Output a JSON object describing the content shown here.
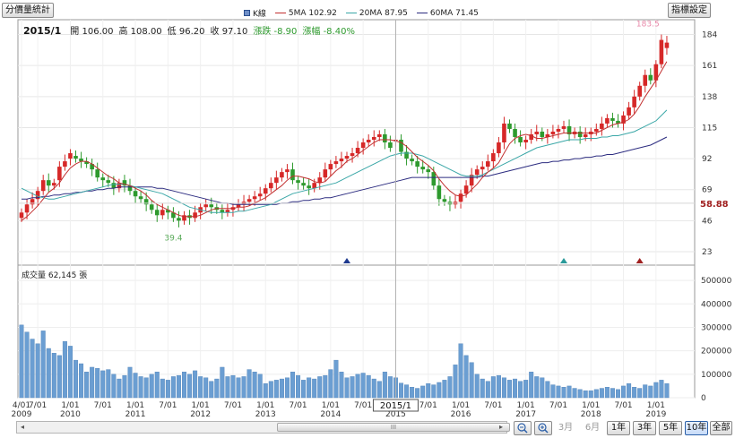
{
  "toolbar": {
    "stats_button": "分價量統計",
    "indicator_button": "指標設定"
  },
  "legend": [
    {
      "label": "K線",
      "color": "#2a4f8f"
    },
    {
      "label": "5MA 102.92",
      "color": "#c23030"
    },
    {
      "label": "20MA 87.95",
      "color": "#3aa7a7"
    },
    {
      "label": "60MA 71.45",
      "color": "#2c2c80"
    }
  ],
  "info": {
    "period": "2015/1",
    "open_label": "開",
    "open": "106.00",
    "high_label": "高",
    "high": "108.00",
    "low_label": "低",
    "low": "96.20",
    "close_label": "收",
    "close": "97.10",
    "change": "漲跌 -8.90",
    "change_pct": "漲幅 -8.40%"
  },
  "volume_label": "成交量 62,145 張",
  "colors": {
    "up": "#d62828",
    "down": "#2e9a2e",
    "volume": "#6b9ed2",
    "ma5": "#c23030",
    "ma20": "#3aa7a7",
    "ma60": "#2c2c80",
    "current_price": "#a02020",
    "cursor": "#b0b0b0"
  },
  "chart_data": {
    "type": "candlestick",
    "price_axis": {
      "ticks": [
        23,
        46,
        69,
        92,
        115,
        138,
        161,
        184
      ],
      "range": [
        13,
        195
      ]
    },
    "volume_axis": {
      "ticks": [
        0,
        100000,
        200000,
        300000,
        400000,
        500000
      ],
      "labels": [
        "0",
        "100000",
        "200000",
        "300000",
        "400000",
        "500000"
      ],
      "range": [
        0,
        550000
      ]
    },
    "x_ticks": [
      {
        "label": "4/01",
        "year": "2009",
        "i": 0
      },
      {
        "label": "7/01",
        "year": "",
        "i": 3
      },
      {
        "label": "1/01",
        "year": "2010",
        "i": 9
      },
      {
        "label": "7/01",
        "year": "",
        "i": 15
      },
      {
        "label": "1/01",
        "year": "2011",
        "i": 21
      },
      {
        "label": "7/01",
        "year": "",
        "i": 27
      },
      {
        "label": "1/01",
        "year": "2012",
        "i": 33
      },
      {
        "label": "7/01",
        "year": "",
        "i": 39
      },
      {
        "label": "1/01",
        "year": "2013",
        "i": 45
      },
      {
        "label": "7/01",
        "year": "",
        "i": 51
      },
      {
        "label": "1/01",
        "year": "2014",
        "i": 57
      },
      {
        "label": "7/01",
        "year": "",
        "i": 63
      },
      {
        "label": "",
        "year": "2015",
        "i": 69
      },
      {
        "label": "7/01",
        "year": "",
        "i": 75
      },
      {
        "label": "1/01",
        "year": "2016",
        "i": 81
      },
      {
        "label": "7/01",
        "year": "",
        "i": 87
      },
      {
        "label": "1/01",
        "year": "2017",
        "i": 93
      },
      {
        "label": "7/01",
        "year": "",
        "i": 99
      },
      {
        "label": "1/01",
        "year": "2018",
        "i": 105
      },
      {
        "label": "7/01",
        "year": "",
        "i": 111
      },
      {
        "label": "1/01",
        "year": "2019",
        "i": 117
      }
    ],
    "cursor_index": 69,
    "cursor_label": "2015/1",
    "current_price": "58.88",
    "current_price_value": 58.88,
    "max_annotation": {
      "label": "183.5",
      "i": 116,
      "value": 183.5
    },
    "min_annotation": {
      "label": "39.4",
      "i": 28,
      "value": 39.4
    },
    "markers": [
      {
        "i": 60,
        "color": "#1f3a8f"
      },
      {
        "i": 100,
        "color": "#2a9a9a"
      },
      {
        "i": 114,
        "color": "#a02020"
      }
    ],
    "closes": [
      52,
      58,
      62,
      68,
      76,
      72,
      74,
      86,
      90,
      96,
      92,
      90,
      88,
      84,
      78,
      76,
      74,
      70,
      74,
      72,
      68,
      64,
      62,
      58,
      54,
      50,
      54,
      52,
      48,
      46,
      50,
      48,
      52,
      56,
      58,
      56,
      54,
      52,
      54,
      56,
      58,
      60,
      62,
      64,
      66,
      70,
      74,
      78,
      82,
      84,
      76,
      74,
      72,
      70,
      74,
      78,
      84,
      88,
      90,
      92,
      94,
      96,
      100,
      104,
      106,
      108,
      110,
      104,
      100,
      106,
      97,
      92,
      90,
      86,
      84,
      82,
      72,
      62,
      60,
      58,
      60,
      66,
      72,
      80,
      84,
      86,
      90,
      96,
      104,
      118,
      114,
      108,
      104,
      106,
      110,
      112,
      108,
      110,
      112,
      114,
      116,
      110,
      112,
      108,
      110,
      112,
      114,
      118,
      122,
      120,
      118,
      124,
      130,
      138,
      146,
      154,
      150,
      162,
      180,
      178
    ],
    "opens": [
      48,
      52,
      58,
      62,
      68,
      76,
      72,
      76,
      86,
      92,
      94,
      92,
      90,
      88,
      84,
      78,
      76,
      74,
      70,
      76,
      72,
      68,
      64,
      62,
      58,
      54,
      50,
      54,
      52,
      48,
      46,
      50,
      48,
      52,
      56,
      58,
      56,
      54,
      52,
      54,
      56,
      58,
      60,
      62,
      64,
      66,
      70,
      74,
      78,
      82,
      84,
      76,
      74,
      72,
      70,
      74,
      78,
      84,
      88,
      90,
      92,
      94,
      96,
      100,
      104,
      106,
      108,
      110,
      104,
      106,
      106,
      97,
      92,
      90,
      86,
      84,
      82,
      72,
      62,
      60,
      58,
      60,
      66,
      72,
      80,
      84,
      86,
      90,
      96,
      104,
      118,
      114,
      108,
      104,
      106,
      110,
      112,
      108,
      110,
      112,
      114,
      116,
      110,
      112,
      108,
      110,
      112,
      114,
      118,
      122,
      120,
      118,
      124,
      130,
      138,
      146,
      154,
      150,
      162,
      174
    ],
    "volumes": [
      310000,
      280000,
      250000,
      230000,
      285000,
      210000,
      190000,
      180000,
      240000,
      220000,
      160000,
      145000,
      110000,
      130000,
      125000,
      115000,
      120000,
      100000,
      80000,
      95000,
      130000,
      105000,
      90000,
      85000,
      100000,
      110000,
      80000,
      75000,
      90000,
      95000,
      110000,
      100000,
      115000,
      90000,
      85000,
      70000,
      80000,
      130000,
      90000,
      95000,
      85000,
      90000,
      120000,
      110000,
      100000,
      60000,
      70000,
      75000,
      80000,
      85000,
      110000,
      95000,
      75000,
      85000,
      80000,
      90000,
      95000,
      120000,
      160000,
      110000,
      85000,
      90000,
      100000,
      105000,
      95000,
      80000,
      70000,
      110000,
      90000,
      85000,
      62145,
      55000,
      45000,
      40000,
      50000,
      60000,
      55000,
      65000,
      75000,
      90000,
      140000,
      230000,
      180000,
      150000,
      100000,
      80000,
      70000,
      90000,
      95000,
      85000,
      75000,
      80000,
      70000,
      75000,
      110000,
      90000,
      85000,
      70000,
      55000,
      50000,
      45000,
      50000,
      40000,
      35000,
      30000,
      30000,
      35000,
      40000,
      45000,
      40000,
      35000,
      50000,
      60000,
      45000,
      40000,
      55000,
      50000,
      65000,
      75000,
      60000
    ],
    "ma5": [
      46,
      49,
      53,
      57,
      62,
      67,
      70,
      74,
      80,
      85,
      88,
      90,
      90,
      88,
      85,
      82,
      79,
      77,
      74,
      73,
      72,
      70,
      68,
      65,
      61,
      58,
      56,
      54,
      52,
      50,
      49,
      49,
      49,
      50,
      52,
      54,
      55,
      55,
      55,
      55,
      56,
      56,
      57,
      59,
      61,
      63,
      66,
      69,
      72,
      76,
      79,
      79,
      78,
      77,
      75,
      74,
      75,
      79,
      83,
      86,
      90,
      92,
      95,
      98,
      101,
      104,
      106,
      106,
      106,
      105,
      104,
      101,
      97,
      93,
      90,
      87,
      83,
      77,
      72,
      68,
      65,
      64,
      65,
      69,
      73,
      78,
      82,
      85,
      89,
      96,
      103,
      107,
      109,
      110,
      109,
      107,
      107,
      108,
      109,
      110,
      111,
      111,
      111,
      111,
      111,
      111,
      111,
      113,
      115,
      117,
      118,
      119,
      121,
      125,
      131,
      138,
      144,
      150,
      157,
      164
    ],
    "ma20": [
      70,
      68,
      66,
      64,
      63,
      62,
      62,
      63,
      64,
      65,
      66,
      67,
      68,
      69,
      70,
      71,
      72,
      73,
      73,
      73,
      72,
      71,
      70,
      69,
      68,
      67,
      66,
      64,
      62,
      60,
      58,
      56,
      55,
      54,
      53,
      52,
      52,
      52,
      52,
      52,
      53,
      53,
      54,
      55,
      56,
      57,
      58,
      60,
      62,
      64,
      66,
      67,
      68,
      69,
      70,
      71,
      72,
      73,
      74,
      76,
      78,
      80,
      82,
      84,
      86,
      88,
      90,
      92,
      94,
      95,
      96,
      96,
      96,
      95,
      94,
      92,
      90,
      88,
      86,
      84,
      82,
      80,
      79,
      79,
      79,
      80,
      82,
      84,
      86,
      88,
      90,
      92,
      94,
      96,
      98,
      100,
      101,
      102,
      103,
      104,
      105,
      106,
      106,
      106,
      107,
      107,
      107,
      108,
      108,
      109,
      109,
      110,
      111,
      112,
      114,
      116,
      118,
      120,
      124,
      128
    ],
    "ma60": [
      62,
      62,
      63,
      63,
      64,
      64,
      65,
      65,
      66,
      66,
      67,
      67,
      68,
      68,
      69,
      69,
      70,
      70,
      71,
      71,
      71,
      71,
      71,
      71,
      71,
      70,
      70,
      69,
      68,
      67,
      66,
      65,
      64,
      63,
      62,
      61,
      60,
      59,
      59,
      58,
      58,
      58,
      58,
      58,
      58,
      58,
      58,
      58,
      59,
      59,
      60,
      60,
      61,
      61,
      62,
      62,
      63,
      63,
      64,
      65,
      66,
      67,
      68,
      69,
      70,
      71,
      72,
      73,
      74,
      75,
      76,
      77,
      78,
      78,
      78,
      78,
      78,
      78,
      78,
      78,
      78,
      78,
      78,
      78,
      78,
      79,
      79,
      80,
      81,
      82,
      83,
      84,
      85,
      86,
      87,
      88,
      89,
      89,
      90,
      90,
      91,
      91,
      92,
      92,
      93,
      93,
      94,
      94,
      95,
      95,
      96,
      97,
      98,
      99,
      100,
      101,
      102,
      104,
      106,
      108
    ]
  },
  "scrollbar": {
    "center_glyph": "III"
  },
  "range_buttons": [
    {
      "label": "3月",
      "active": false,
      "enabled": false
    },
    {
      "label": "6月",
      "active": false,
      "enabled": false
    },
    {
      "label": "1年",
      "active": false,
      "enabled": true
    },
    {
      "label": "3年",
      "active": false,
      "enabled": true
    },
    {
      "label": "5年",
      "active": false,
      "enabled": true
    },
    {
      "label": "10年",
      "active": true,
      "enabled": true
    },
    {
      "label": "全部",
      "active": false,
      "enabled": true
    }
  ]
}
